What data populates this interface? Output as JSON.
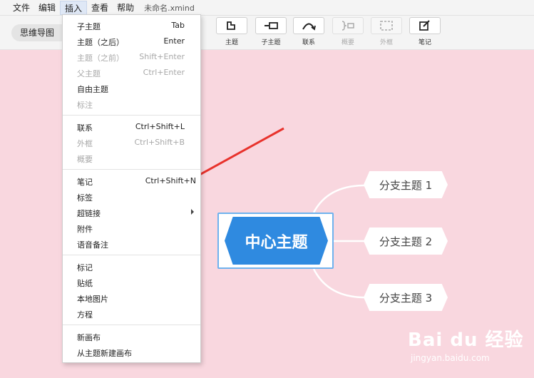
{
  "menubar": {
    "items": [
      "文件",
      "编辑",
      "插入",
      "查看",
      "帮助"
    ],
    "document_title": "未命名.xmind"
  },
  "toolbar": {
    "mode_label": "思维导图",
    "tools": [
      {
        "label": "主题",
        "icon": "topic-icon"
      },
      {
        "label": "子主题",
        "icon": "subtopic-icon"
      },
      {
        "label": "联系",
        "icon": "relationship-icon"
      },
      {
        "label": "概要",
        "icon": "summary-icon"
      },
      {
        "label": "外框",
        "icon": "boundary-icon"
      },
      {
        "label": "笔记",
        "icon": "note-icon"
      }
    ]
  },
  "insert_menu": {
    "groups": [
      [
        {
          "label": "子主题",
          "shortcut": "Tab"
        },
        {
          "label": "主题（之后）",
          "shortcut": "Enter"
        },
        {
          "label": "主题（之前）",
          "shortcut": "Shift+Enter"
        },
        {
          "label": "父主题",
          "shortcut": "Ctrl+Enter"
        },
        {
          "label": "自由主题",
          "shortcut": ""
        },
        {
          "label": "标注",
          "shortcut": ""
        }
      ],
      [
        {
          "label": "联系",
          "shortcut": "Ctrl+Shift+L"
        },
        {
          "label": "外框",
          "shortcut": "Ctrl+Shift+B"
        },
        {
          "label": "概要",
          "shortcut": ""
        }
      ],
      [
        {
          "label": "笔记",
          "shortcut": "Ctrl+Shift+N"
        },
        {
          "label": "标签",
          "shortcut": ""
        },
        {
          "label": "超链接",
          "shortcut": ""
        },
        {
          "label": "附件",
          "shortcut": ""
        },
        {
          "label": "语音备注",
          "shortcut": ""
        }
      ],
      [
        {
          "label": "标记",
          "shortcut": ""
        },
        {
          "label": "贴纸",
          "shortcut": ""
        },
        {
          "label": "本地图片",
          "shortcut": ""
        },
        {
          "label": "方程",
          "shortcut": ""
        }
      ],
      [
        {
          "label": "新画布",
          "shortcut": ""
        },
        {
          "label": "从主题新建画布",
          "shortcut": ""
        }
      ]
    ]
  },
  "mindmap": {
    "central_topic": "中心主题",
    "branches": [
      "分支主题 1",
      "分支主题 2",
      "分支主题 3"
    ]
  },
  "colors": {
    "canvas_background": "#f9d7df",
    "central_topic_fill": "#2f8ae0",
    "annotation_arrow": "#e8322c"
  },
  "watermark": {
    "brand": "Bai du 经验",
    "url": "jingyan.baidu.com"
  }
}
